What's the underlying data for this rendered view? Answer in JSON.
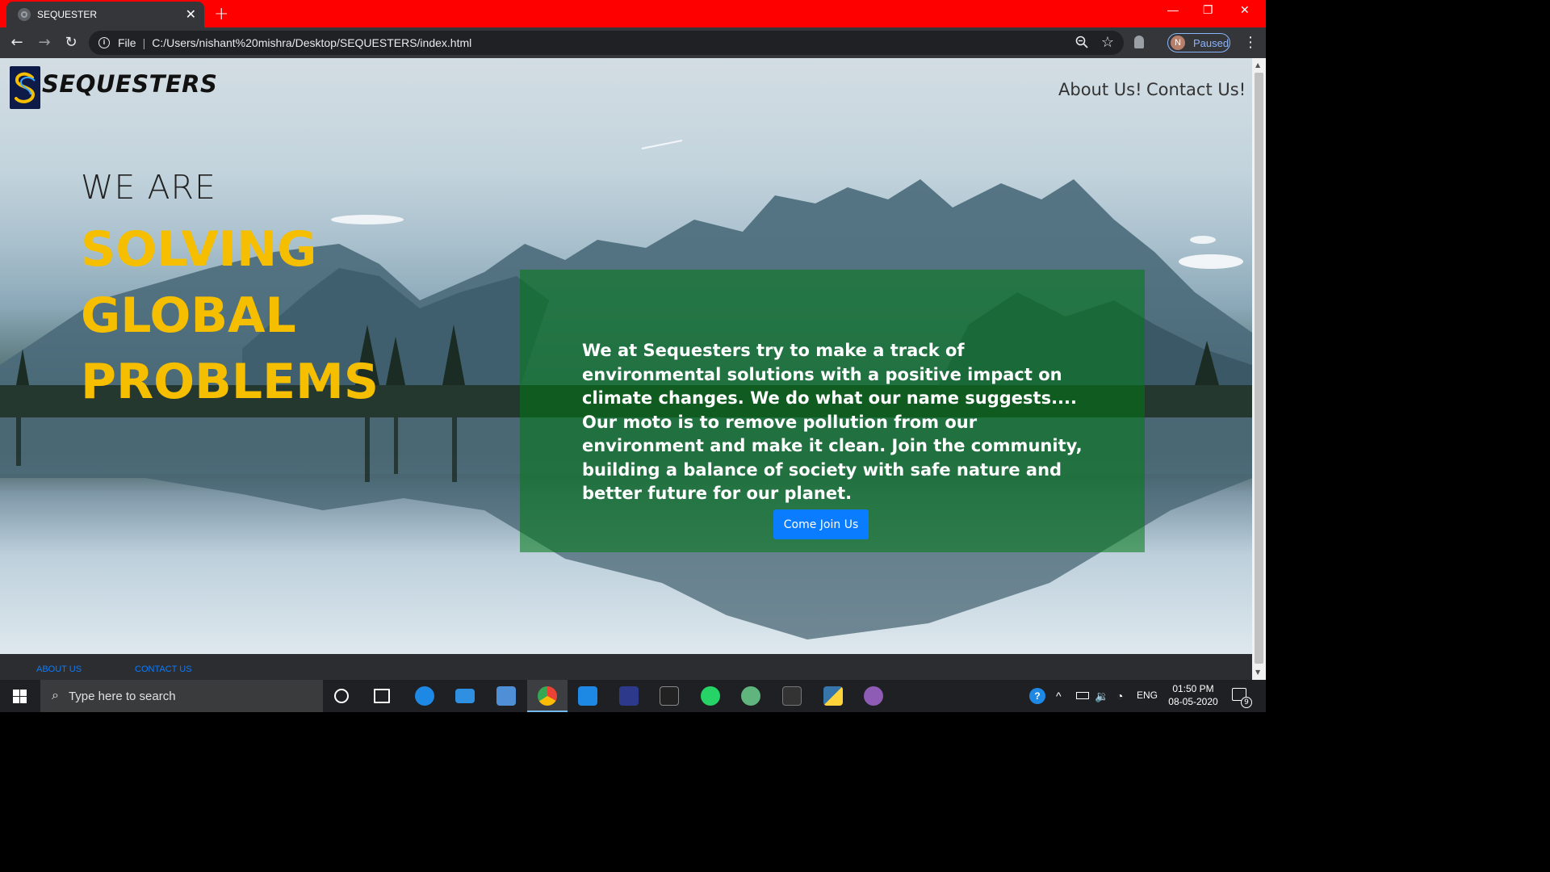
{
  "browser": {
    "tab_title": "SEQUESTER",
    "new_tab_symbol": "+",
    "address_scheme": "File",
    "address_url": "C:/Users/nishant%20mishra/Desktop/SEQUESTERS/index.html",
    "profile_initial": "N",
    "profile_status": "Paused"
  },
  "site": {
    "brand_name": "SEQUESTERS",
    "nav": [
      {
        "label": "About Us!"
      },
      {
        "label": "Contact Us!"
      }
    ],
    "hero": {
      "line1": "WE ARE",
      "line2": "SOLVING",
      "line3": "GLOBAL",
      "line4": "PROBLEMS"
    },
    "panel": {
      "text": "We at Sequesters try to make a track of environmental solutions with a positive impact on climate changes. We do what our name suggests.... Our moto is to remove pollution from our environment and make it clean. Join the community, building a balance of society with safe nature and better future for our planet.",
      "button_label": "Come Join Us"
    },
    "footer": {
      "links": [
        {
          "label": "ABOUT US"
        },
        {
          "label": "CONTACT US"
        }
      ]
    },
    "colors": {
      "hero_accent": "#f5bf00",
      "panel_green": "#007814",
      "button_blue": "#0a7cff",
      "titlebar_red": "#ff0000"
    }
  },
  "taskbar": {
    "search_placeholder": "Type here to search",
    "language": "ENG",
    "time": "01:50 PM",
    "date": "08-05-2020",
    "notification_count": "9",
    "apps": [
      "cortana-icon",
      "task-view-icon",
      "edge-icon",
      "mail-icon",
      "file-explorer-icon",
      "chrome-icon",
      "vscode-icon",
      "dev-cpp-icon",
      "terminal-icon",
      "whatsapp-icon",
      "atom-icon",
      "mysql-icon",
      "python-icon",
      "github-icon"
    ]
  }
}
